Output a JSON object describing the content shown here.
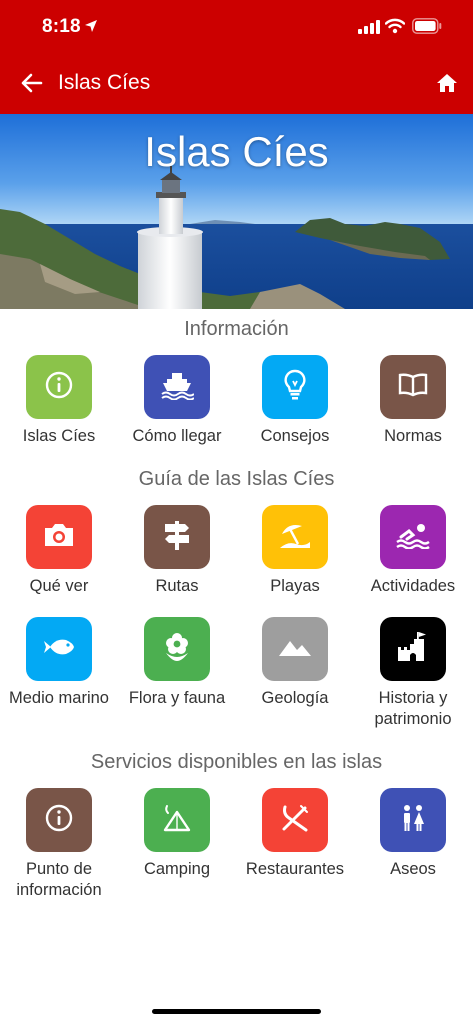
{
  "status_bar": {
    "time": "8:18"
  },
  "app_bar": {
    "title": "Islas Cíes"
  },
  "hero": {
    "title": "Islas Cíes"
  },
  "sections": {
    "info": {
      "title": "Información",
      "items": [
        {
          "label": "Islas Cíes",
          "icon": "info-icon",
          "color": "#8bc34a"
        },
        {
          "label": "Cómo llegar",
          "icon": "ship-icon",
          "color": "#3f51b5"
        },
        {
          "label": "Consejos",
          "icon": "lightbulb-icon",
          "color": "#03a9f4"
        },
        {
          "label": "Normas",
          "icon": "book-icon",
          "color": "#795548"
        }
      ]
    },
    "guide": {
      "title": "Guía de las Islas Cíes",
      "items": [
        {
          "label": "Qué ver",
          "icon": "camera-icon",
          "color": "#f44336"
        },
        {
          "label": "Rutas",
          "icon": "signpost-icon",
          "color": "#795548"
        },
        {
          "label": "Playas",
          "icon": "beach-icon",
          "color": "#ffc107"
        },
        {
          "label": "Actividades",
          "icon": "swimmer-icon",
          "color": "#9c27b0"
        },
        {
          "label": "Medio marino",
          "icon": "fish-icon",
          "color": "#03a9f4"
        },
        {
          "label": "Flora y fauna",
          "icon": "flower-icon",
          "color": "#4caf50"
        },
        {
          "label": "Geología",
          "icon": "mountains-icon",
          "color": "#9e9e9e"
        },
        {
          "label": "Historia y patrimonio",
          "icon": "castle-icon",
          "color": "#000000"
        }
      ]
    },
    "services": {
      "title": "Servicios disponibles en las islas",
      "items": [
        {
          "label": "Punto de información",
          "icon": "info-icon",
          "color": "#795548"
        },
        {
          "label": "Camping",
          "icon": "tent-icon",
          "color": "#4caf50"
        },
        {
          "label": "Restaurantes",
          "icon": "utensils-icon",
          "color": "#f44336"
        },
        {
          "label": "Aseos",
          "icon": "restroom-icon",
          "color": "#3f51b5"
        }
      ]
    }
  }
}
